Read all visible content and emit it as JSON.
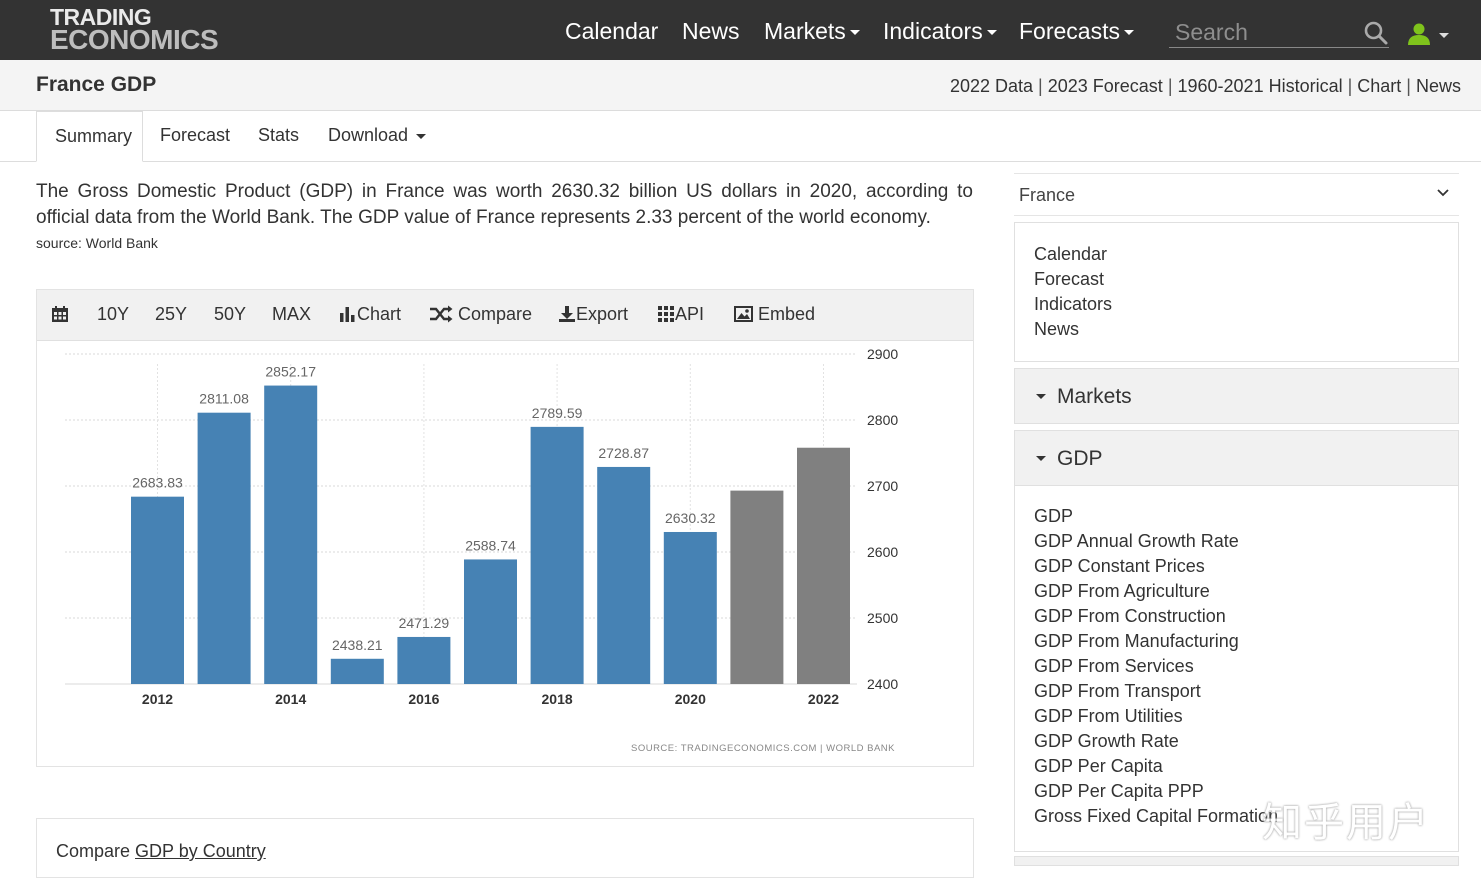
{
  "nav": {
    "logo_line1": "TRADING",
    "logo_line2": "ECONOMICS",
    "items": [
      {
        "label": "Calendar"
      },
      {
        "label": "News"
      },
      {
        "label": "Markets"
      },
      {
        "label": "Indicators"
      },
      {
        "label": "Forecasts"
      }
    ],
    "search_placeholder": "Search",
    "user_icon_color": "#7fc31c"
  },
  "titlebar": {
    "title": "France GDP",
    "links": [
      "2022 Data",
      "2023 Forecast",
      "1960-2021 Historical",
      "Chart",
      "News"
    ]
  },
  "tabs": [
    "Summary",
    "Forecast",
    "Stats",
    "Download"
  ],
  "summary": {
    "text": "The Gross Domestic Product (GDP) in France was worth 2630.32 billion US dollars in 2020, according to official data from the World Bank. The GDP value of France represents 2.33 percent of the world economy.",
    "source": "source: World Bank"
  },
  "chart_toolbar": [
    "10Y",
    "25Y",
    "50Y",
    "MAX",
    "Chart",
    "Compare",
    "Export",
    "API",
    "Embed"
  ],
  "chart_data": {
    "type": "bar",
    "categories": [
      "2012",
      "2013",
      "2014",
      "2015",
      "2016",
      "2017",
      "2018",
      "2019",
      "2020",
      "2021",
      "2022"
    ],
    "values": [
      2683.83,
      2811.08,
      2852.17,
      2438.21,
      2471.29,
      2588.74,
      2789.59,
      2728.87,
      2630.32,
      2693,
      2758
    ],
    "value_labels": [
      "2683.83",
      "2811.08",
      "2852.17",
      "2438.21",
      "2471.29",
      "2588.74",
      "2789.59",
      "2728.87",
      "2630.32",
      "",
      ""
    ],
    "bar_colors": [
      "#4682b4",
      "#4682b4",
      "#4682b4",
      "#4682b4",
      "#4682b4",
      "#4682b4",
      "#4682b4",
      "#4682b4",
      "#4682b4",
      "#808080",
      "#808080"
    ],
    "x_tick_labels": [
      "2012",
      "",
      "2014",
      "",
      "2016",
      "",
      "2018",
      "",
      "2020",
      "",
      "2022"
    ],
    "ylim": [
      2400,
      2900
    ],
    "y_ticks": [
      2400,
      2500,
      2600,
      2700,
      2800,
      2900
    ],
    "y_axis_side": "right",
    "grid": true,
    "source_text": "SOURCE: TRADINGECONOMICS.COM  |  WORLD BANK"
  },
  "compare": {
    "prefix": "Compare ",
    "link": "GDP by Country"
  },
  "sidebar": {
    "country": "France",
    "links": [
      "Calendar",
      "Forecast",
      "Indicators",
      "News"
    ],
    "sections": [
      "Markets",
      "GDP"
    ],
    "gdp_links": [
      "GDP",
      "GDP Annual Growth Rate",
      "GDP Constant Prices",
      "GDP From Agriculture",
      "GDP From Construction",
      "GDP From Manufacturing",
      "GDP From Services",
      "GDP From Transport",
      "GDP From Utilities",
      "GDP Growth Rate",
      "GDP Per Capita",
      "GDP Per Capita PPP",
      "Gross Fixed Capital Formation"
    ]
  },
  "watermark": "知乎用户"
}
